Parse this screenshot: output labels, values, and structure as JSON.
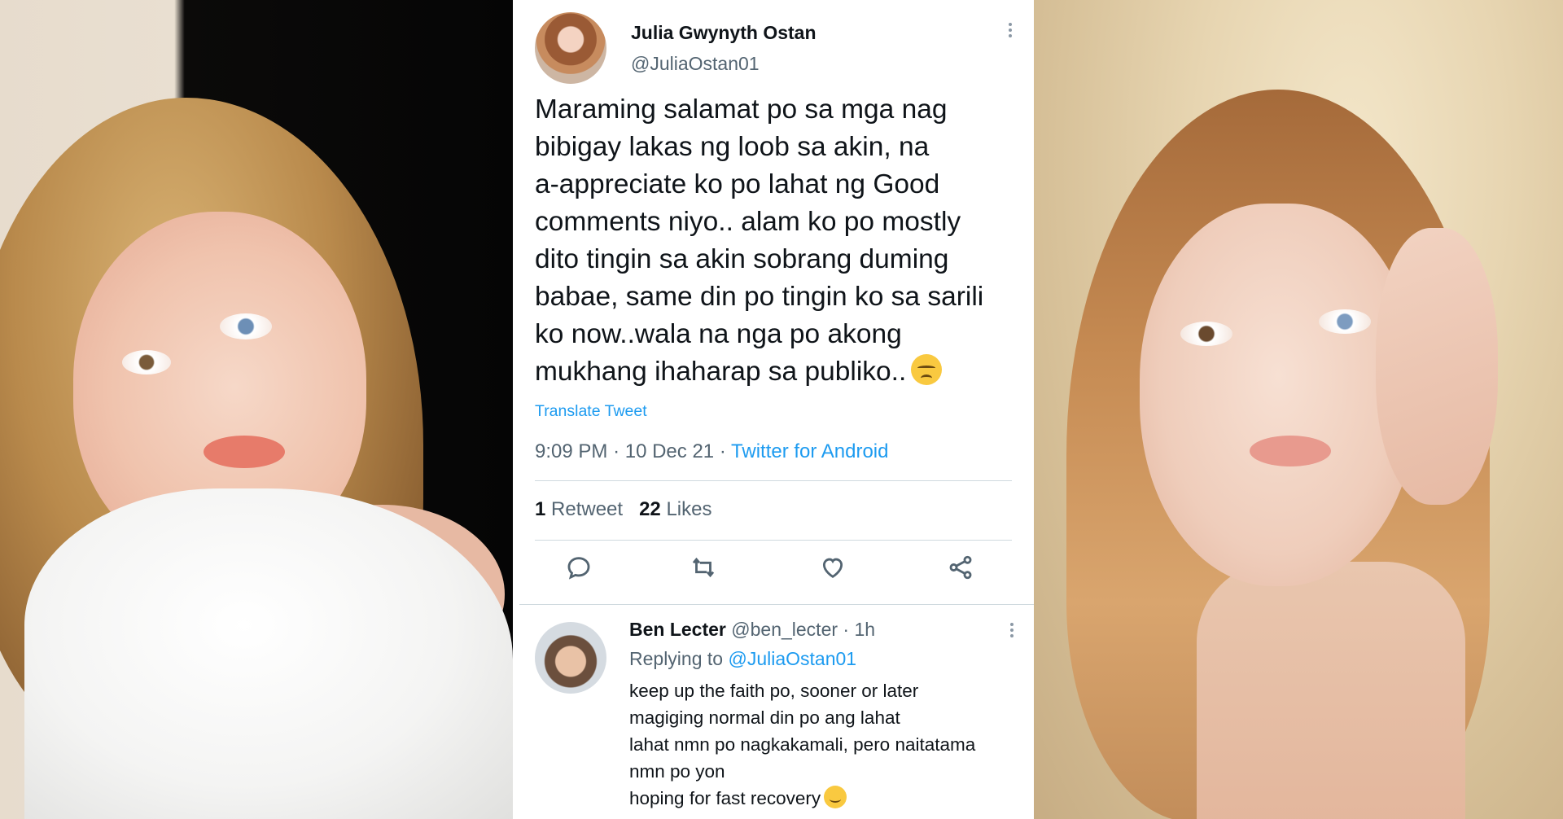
{
  "tweet": {
    "author_name": "Julia Gwynyth Ostan",
    "author_handle": "@JuliaOstan01",
    "text_lines": [
      "Maraming salamat po sa mga nag",
      "bibigay lakas ng loob sa akin, na",
      "a-appreciate ko po lahat ng Good",
      "comments niyo.. alam ko po mostly",
      "dito tingin sa akin sobrang duming",
      "babae, same din po tingin ko sa sarili",
      "ko now..wala na nga po akong",
      "mukhang ihaharap sa publiko.."
    ],
    "translate_label": "Translate Tweet",
    "time": "9:09 PM",
    "date": "10 Dec 21",
    "source": "Twitter for Android",
    "retweet_count": "1",
    "retweet_label": "Retweet",
    "likes_count": "22",
    "likes_label": "Likes"
  },
  "reply": {
    "author_name": "Ben Lecter",
    "author_handle": "@ben_lecter",
    "age": "1h",
    "replying_label": "Replying to",
    "replying_to": "@JuliaOstan01",
    "lines": [
      "keep up the faith po, sooner or later",
      "magiging normal din po ang lahat",
      "lahat nmn po nagkakamali, pero naitatama",
      "nmn po yon",
      "hoping for fast recovery"
    ]
  },
  "icons": {
    "reply": "reply-icon",
    "retweet": "retweet-icon",
    "like": "heart-icon",
    "share": "share-icon",
    "more": "more-icon"
  },
  "colors": {
    "link": "#1d9bf0",
    "text": "#0f1419",
    "muted": "#536471"
  }
}
